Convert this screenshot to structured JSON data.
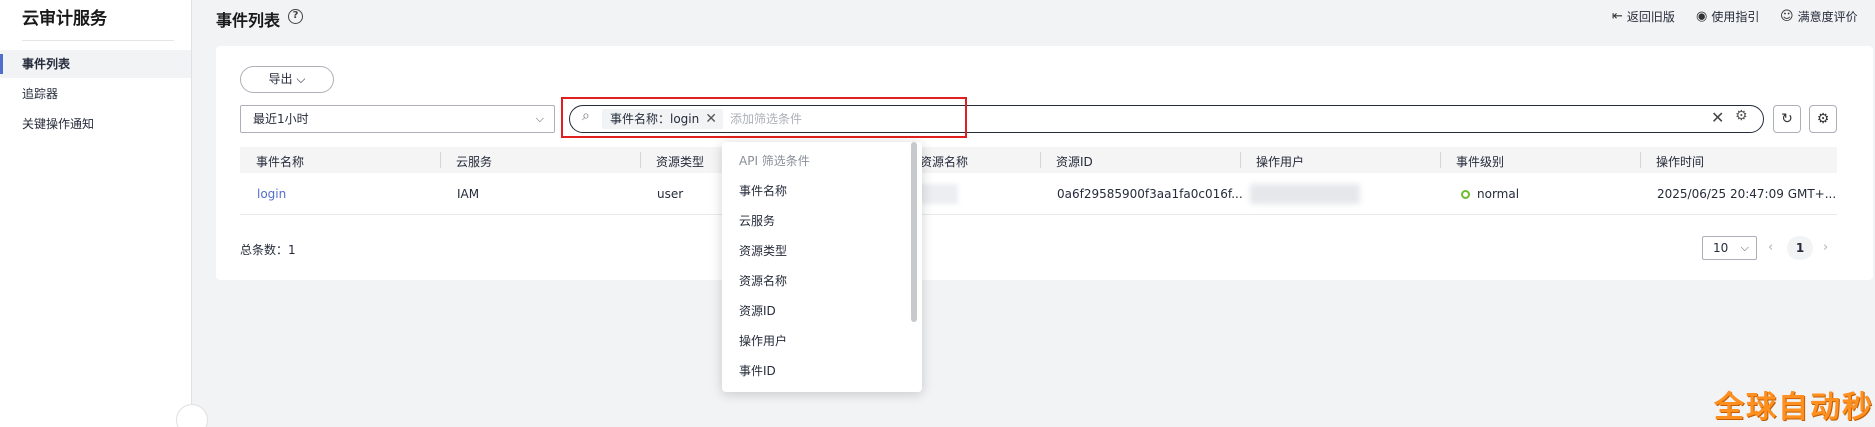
{
  "sidebar": {
    "title": "云审计服务",
    "items": [
      {
        "label": "事件列表",
        "active": true
      },
      {
        "label": "追踪器",
        "active": false
      },
      {
        "label": "关键操作通知",
        "active": false
      }
    ]
  },
  "header": {
    "title": "事件列表",
    "help_icon": "?",
    "links": [
      {
        "label": "返回旧版",
        "icon": "back-icon"
      },
      {
        "label": "使用指引",
        "icon": "eye-icon"
      },
      {
        "label": "满意度评价",
        "icon": "smile-icon"
      }
    ]
  },
  "toolbar": {
    "export_label": "导出",
    "time_select": "最近1小时"
  },
  "search": {
    "tag_label": "事件名称：login",
    "placeholder": "添加筛选条件"
  },
  "table": {
    "columns": [
      "事件名称",
      "云服务",
      "资源类型",
      "资源名称",
      "资源ID",
      "操作用户",
      "事件级别",
      "操作时间"
    ],
    "rows": [
      {
        "event_name": "login",
        "service": "IAM",
        "resource_type": "user",
        "resource_id": "0a6f29585900f3aa1fa0c016f...",
        "level": "normal",
        "time": "2025/06/25 20:47:09 GMT+..."
      }
    ]
  },
  "footer": {
    "total": "总条数：1",
    "page_size": "10",
    "current_page": "1"
  },
  "dropdown": {
    "title": "API 筛选条件",
    "items": [
      "事件名称",
      "云服务",
      "资源类型",
      "资源名称",
      "资源ID",
      "操作用户",
      "事件ID"
    ]
  },
  "watermark": "全球自动秒收",
  "colors": {
    "accent": "#526ecc",
    "highlight_border": "#e02020",
    "status_normal": "#6fbd2e",
    "watermark": "#ff8f1f"
  }
}
